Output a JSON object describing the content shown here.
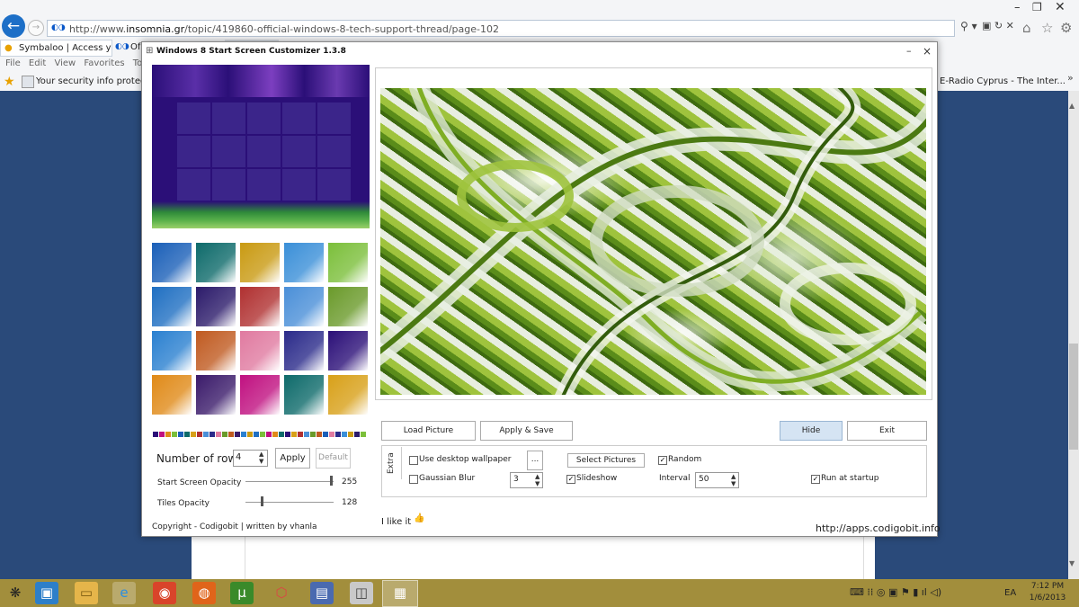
{
  "browser": {
    "url": "http://www.insomnia.gr/topic/419860-official-windows-8-tech-support-thread/page-102",
    "url_prefix": "http://www.",
    "url_domain": "insomnia.gr",
    "url_path": "/topic/419860-official-windows-8-tech-support-thread/page-102",
    "tabs": [
      {
        "label": "Symbaloo | Access you..."
      },
      {
        "label": "Of"
      }
    ],
    "menu": [
      "File",
      "Edit",
      "View",
      "Favorites",
      "Tools"
    ],
    "favorites_bar": {
      "item_left": "Your security info protects...",
      "item_right": "E-Radio Cyprus - The Inter..."
    },
    "accent_color": "#1d6fc7"
  },
  "dialog": {
    "title": "Windows 8 Start Screen Customizer 1.3.8",
    "min_glyph": "–",
    "close_glyph": "×",
    "rows_label": "Number of rows:",
    "rows_value": "4",
    "apply_label": "Apply",
    "default_label": "Default",
    "start_opacity_label": "Start Screen Opacity",
    "start_opacity_value": "255",
    "tiles_opacity_label": "Tiles Opacity",
    "tiles_opacity_value": "128",
    "copyright": "Copyright - Codigobit | written by vhanla",
    "buttons": {
      "load": "Load Picture",
      "apply_save": "Apply & Save",
      "hide": "Hide",
      "exit": "Exit"
    },
    "extra": {
      "label": "Extra",
      "use_desktop_wallpaper": {
        "label": "Use desktop wallpaper",
        "checked": false
      },
      "dots": "...",
      "select_pictures": "Select Pictures",
      "random": {
        "label": "Random",
        "checked": true
      },
      "gaussian_blur": {
        "label": "Gaussian Blur",
        "checked": false
      },
      "blur_value": "3",
      "slideshow": {
        "label": "Slideshow",
        "checked": true
      },
      "interval_label": "Interval",
      "interval_value": "50",
      "run_at_startup": {
        "label": "Run at startup",
        "checked": true
      }
    },
    "like_text": "I like it",
    "website": "http://apps.codigobit.info",
    "thumb_colors": [
      "#1a5fb8",
      "#0d6a6a",
      "#c99a12",
      "#3a8fd8",
      "#7bbf3a",
      "#1f6fc2",
      "#2b1a6a",
      "#b03030",
      "#4a8fd8",
      "#6a9a2a",
      "#2a80d0",
      "#c05a20",
      "#e07aa0",
      "#2a2a8a",
      "#2b0f78",
      "#e08a18",
      "#3a1a6a",
      "#c01080",
      "#0d6a6a",
      "#d8a018"
    ],
    "strip_colors": [
      "#2b0f78",
      "#c01080",
      "#e08a18",
      "#7bbf3a",
      "#1a5fb8",
      "#0d6a6a",
      "#d8a018",
      "#b03030",
      "#4a8fd8",
      "#2a2a8a",
      "#e07aa0",
      "#6a9a2a",
      "#c05a20",
      "#3a1a6a",
      "#2a80d0",
      "#c99a12",
      "#1f6fc2",
      "#7bbf3a",
      "#c01080",
      "#e08a18",
      "#0d6a6a",
      "#2b0f78",
      "#d8a018",
      "#b03030",
      "#4a8fd8",
      "#6a9a2a",
      "#c05a20",
      "#1a5fb8",
      "#e07aa0",
      "#2a2a8a",
      "#3a8fd8",
      "#c99a12",
      "#2b1a6a",
      "#7bbf3a"
    ]
  },
  "taskbar": {
    "lang": "EA",
    "time": "7:12 PM",
    "date": "1/6/2013",
    "color": "#a28e3c"
  }
}
